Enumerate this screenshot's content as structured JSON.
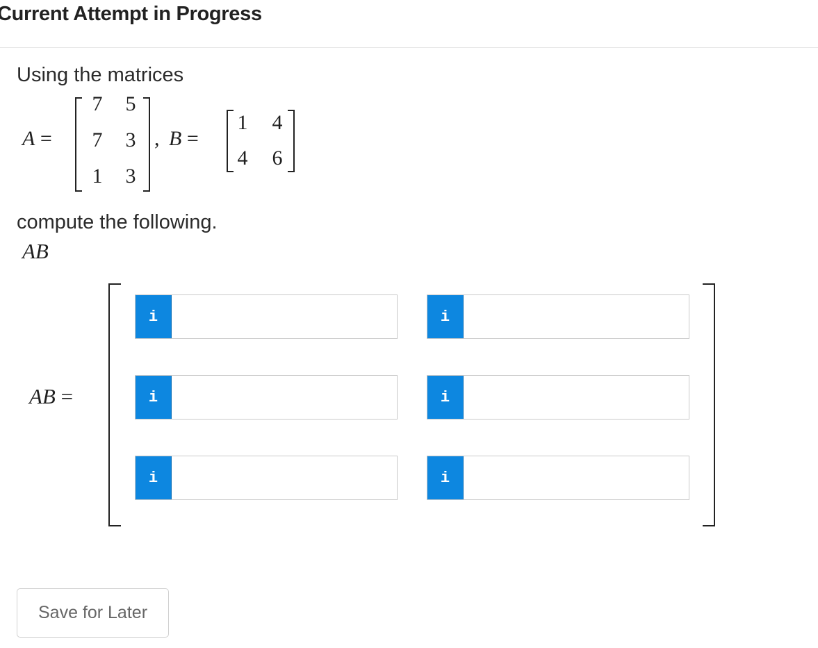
{
  "header": {
    "title": "Current Attempt in Progress"
  },
  "question": {
    "intro": "Using the matrices",
    "matrix_a_label": "A =",
    "matrix_a": [
      [
        "7",
        "5"
      ],
      [
        "7",
        "3"
      ],
      [
        "1",
        "3"
      ]
    ],
    "separator": ",",
    "matrix_b_label": "B =",
    "matrix_b": [
      [
        "1",
        "4"
      ],
      [
        "4",
        "6"
      ]
    ],
    "instruction": "compute the following.",
    "expression": "AB",
    "answer_label": "AB ="
  },
  "answer": {
    "info_icon_glyph": "i",
    "fields": [
      {
        "value": "",
        "placeholder": ""
      },
      {
        "value": "",
        "placeholder": ""
      },
      {
        "value": "",
        "placeholder": ""
      },
      {
        "value": "",
        "placeholder": ""
      },
      {
        "value": "",
        "placeholder": ""
      },
      {
        "value": "",
        "placeholder": ""
      }
    ]
  },
  "actions": {
    "save_label": "Save for Later"
  },
  "colors": {
    "info_button": "#0d87e0",
    "divider": "#e6e6e6"
  }
}
